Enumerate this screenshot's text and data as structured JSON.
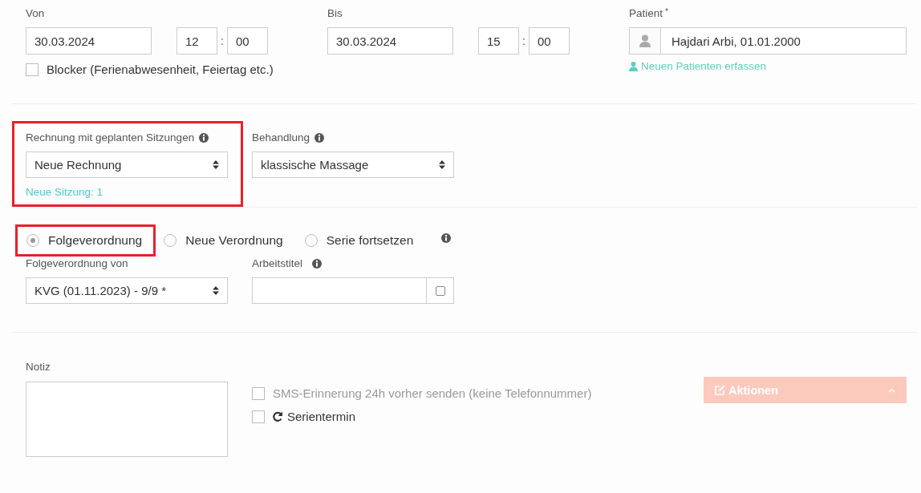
{
  "von": {
    "label": "Von",
    "date": "30.03.2024",
    "hour": "12",
    "separator": ":",
    "minute": "00"
  },
  "bis": {
    "label": "Bis",
    "date": "30.03.2024",
    "hour": "15",
    "separator": ":",
    "minute": "00"
  },
  "patient": {
    "label": "Patient",
    "required_mark": "*",
    "value": "Hajdari Arbi, 01.01.2000",
    "link": "Neuen Patienten erfassen"
  },
  "blocker": {
    "label": "Blocker (Ferienabwesenheit, Feiertag etc.)",
    "checked": false
  },
  "invoice": {
    "label": "Rechnung mit geplanten Sitzungen",
    "value": "Neue Rechnung",
    "note": "Neue Sitzung: 1",
    "highlighted": true
  },
  "treatment": {
    "label": "Behandlung",
    "value": "klassische Massage"
  },
  "prescription_type": [
    {
      "label": "Folgeverordnung",
      "selected": true,
      "highlighted": true
    },
    {
      "label": "Neue Verordnung",
      "selected": false,
      "highlighted": false
    },
    {
      "label": "Serie fortsetzen",
      "selected": false,
      "highlighted": false
    }
  ],
  "follow_up_of": {
    "label": "Folgeverordnung von",
    "value": "KVG (01.11.2023) - 9/9 *"
  },
  "working_title": {
    "label": "Arbeitstitel",
    "checked": false
  },
  "note": {
    "label": "Notiz"
  },
  "options": [
    {
      "kind": "plain",
      "label": "SMS-Erinnerung 24h vorher senden (keine Telefonnummer)",
      "checked": false,
      "disabled": true
    },
    {
      "kind": "repeat",
      "label": "Serientermin",
      "checked": false,
      "disabled": false
    }
  ],
  "actions_button": {
    "label": "Aktionen",
    "disabled": true
  }
}
